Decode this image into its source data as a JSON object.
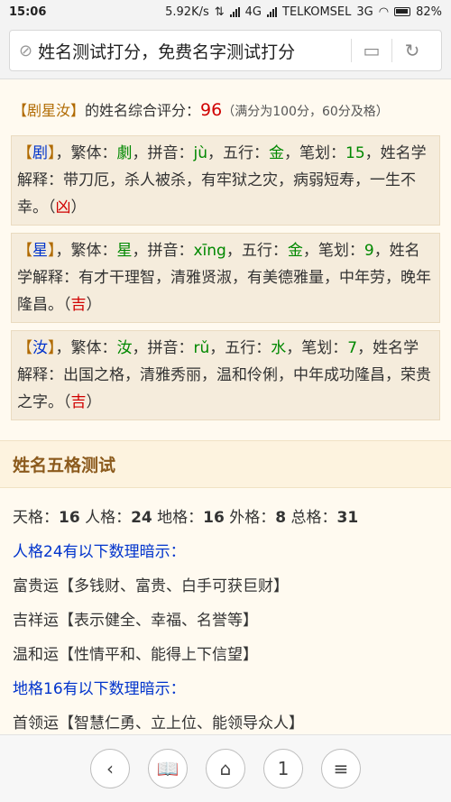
{
  "statusbar": {
    "time": "15:06",
    "speed": "5.92K/s",
    "network": "4G",
    "carrier": "TELKOMSEL",
    "carrier_net": "3G",
    "battery": "82%"
  },
  "urlbar": {
    "title": "姓名测试打分，免费名字测试打分"
  },
  "summary": {
    "name_bracket": "【剧星汝】",
    "text": "的姓名综合评分：",
    "score": "96",
    "note": "（满分为100分，60分及格）"
  },
  "chars": [
    {
      "char": "剧",
      "fanti_label": "，繁体：",
      "fanti": "劇",
      "pinyin_label": "，拼音：",
      "pinyin": "jù",
      "wuxing_label": "，五行：",
      "wuxing": "金",
      "bihua_label": "，笔划：",
      "bihua": "15",
      "explain_label": "，姓名学解释：",
      "explain": "带刀厄，杀人被杀，有牢狱之灾，病弱短寿，一生不幸。",
      "verdict": "凶"
    },
    {
      "char": "星",
      "fanti_label": "，繁体：",
      "fanti": "星",
      "pinyin_label": "，拼音：",
      "pinyin": "xīng",
      "wuxing_label": "，五行：",
      "wuxing": "金",
      "bihua_label": "，笔划：",
      "bihua": "9",
      "explain_label": "，姓名学解释：",
      "explain": "有才干理智，清雅贤淑，有美德雅量，中年劳，晚年隆昌。",
      "verdict": "吉"
    },
    {
      "char": "汝",
      "fanti_label": "，繁体：",
      "fanti": "汝",
      "pinyin_label": "，拼音：",
      "pinyin": "rǔ",
      "wuxing_label": "，五行：",
      "wuxing": "水",
      "bihua_label": "，笔划：",
      "bihua": "7",
      "explain_label": "，姓名学解释：",
      "explain": "出国之格，清雅秀丽，温和伶俐，中年成功隆昌，荣贵之字。",
      "verdict": "吉"
    }
  ],
  "wuge": {
    "section_title": "姓名五格测试",
    "tian_label": "天格：",
    "tian": "16",
    "ren_label": " 人格：",
    "ren": "24",
    "di_label": " 地格：",
    "di": "16",
    "wai_label": " 外格：",
    "wai": "8",
    "zong_label": " 总格：",
    "zong": "31",
    "ren_hint": "人格24有以下数理暗示：",
    "ren_items": [
      "富贵运【多钱财、富贵、白手可获巨财】",
      "吉祥运【表示健全、幸福、名誉等】",
      "温和运【性情平和、能得上下信望】"
    ],
    "di_hint": "地格16有以下数理暗示：",
    "di_items": [
      "首领运【智慧仁勇、立上位、能领导众人】"
    ]
  },
  "bottomnav": {
    "tabs_count": "1"
  }
}
